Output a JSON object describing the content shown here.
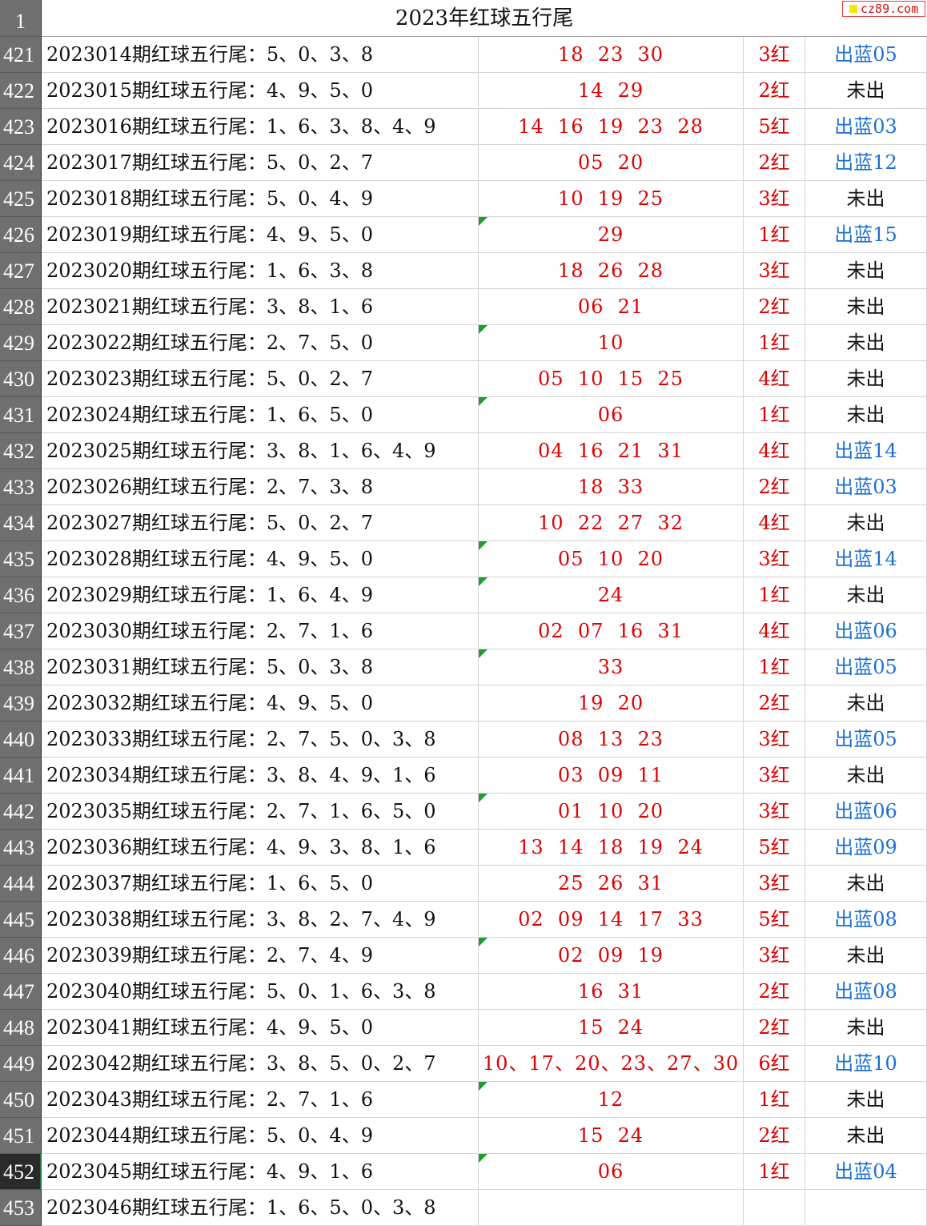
{
  "header": {
    "row_number": "1",
    "title": "2023年红球五行尾",
    "logo_text": "cz89.com"
  },
  "rows": [
    {
      "n": "421",
      "desc": "2023014期红球五行尾：5、0、3、8",
      "balls": "18  23  30",
      "hits": "3红",
      "blue": "出蓝05",
      "blue_hit": true,
      "flag": false
    },
    {
      "n": "422",
      "desc": "2023015期红球五行尾：4、9、5、0",
      "balls": "14  29",
      "hits": "2红",
      "blue": "未出",
      "blue_hit": false,
      "flag": false
    },
    {
      "n": "423",
      "desc": "2023016期红球五行尾：1、6、3、8、4、9",
      "balls": "14  16  19  23  28",
      "hits": "5红",
      "blue": "出蓝03",
      "blue_hit": true,
      "flag": false
    },
    {
      "n": "424",
      "desc": "2023017期红球五行尾：5、0、2、7",
      "balls": "05  20",
      "hits": "2红",
      "blue": "出蓝12",
      "blue_hit": true,
      "flag": false
    },
    {
      "n": "425",
      "desc": "2023018期红球五行尾：5、0、4、9",
      "balls": "10  19  25",
      "hits": "3红",
      "blue": "未出",
      "blue_hit": false,
      "flag": false
    },
    {
      "n": "426",
      "desc": "2023019期红球五行尾：4、9、5、0",
      "balls": "29",
      "hits": "1红",
      "blue": "出蓝15",
      "blue_hit": true,
      "flag": true
    },
    {
      "n": "427",
      "desc": "2023020期红球五行尾：1、6、3、8",
      "balls": "18  26  28",
      "hits": "3红",
      "blue": "未出",
      "blue_hit": false,
      "flag": false
    },
    {
      "n": "428",
      "desc": "2023021期红球五行尾：3、8、1、6",
      "balls": "06  21",
      "hits": "2红",
      "blue": "未出",
      "blue_hit": false,
      "flag": false
    },
    {
      "n": "429",
      "desc": "2023022期红球五行尾：2、7、5、0",
      "balls": "10",
      "hits": "1红",
      "blue": "未出",
      "blue_hit": false,
      "flag": true
    },
    {
      "n": "430",
      "desc": "2023023期红球五行尾：5、0、2、7",
      "balls": "05  10  15  25",
      "hits": "4红",
      "blue": "未出",
      "blue_hit": false,
      "flag": false
    },
    {
      "n": "431",
      "desc": "2023024期红球五行尾：1、6、5、0",
      "balls": "06",
      "hits": "1红",
      "blue": "未出",
      "blue_hit": false,
      "flag": true
    },
    {
      "n": "432",
      "desc": "2023025期红球五行尾：3、8、1、6、4、9",
      "balls": "04  16  21  31",
      "hits": "4红",
      "blue": "出蓝14",
      "blue_hit": true,
      "flag": false
    },
    {
      "n": "433",
      "desc": "2023026期红球五行尾：2、7、3、8",
      "balls": "18  33",
      "hits": "2红",
      "blue": "出蓝03",
      "blue_hit": true,
      "flag": false
    },
    {
      "n": "434",
      "desc": "2023027期红球五行尾：5、0、2、7",
      "balls": "10  22  27  32",
      "hits": "4红",
      "blue": "未出",
      "blue_hit": false,
      "flag": false
    },
    {
      "n": "435",
      "desc": "2023028期红球五行尾：4、9、5、0",
      "balls": "05  10  20",
      "hits": "3红",
      "blue": "出蓝14",
      "blue_hit": true,
      "flag": true
    },
    {
      "n": "436",
      "desc": "2023029期红球五行尾：1、6、4、9",
      "balls": "24",
      "hits": "1红",
      "blue": "未出",
      "blue_hit": false,
      "flag": true
    },
    {
      "n": "437",
      "desc": "2023030期红球五行尾：2、7、1、6",
      "balls": "02  07  16  31",
      "hits": "4红",
      "blue": "出蓝06",
      "blue_hit": true,
      "flag": false
    },
    {
      "n": "438",
      "desc": "2023031期红球五行尾：5、0、3、8",
      "balls": "33",
      "hits": "1红",
      "blue": "出蓝05",
      "blue_hit": true,
      "flag": true
    },
    {
      "n": "439",
      "desc": "2023032期红球五行尾：4、9、5、0",
      "balls": "19  20",
      "hits": "2红",
      "blue": "未出",
      "blue_hit": false,
      "flag": false
    },
    {
      "n": "440",
      "desc": "2023033期红球五行尾：2、7、5、0、3、8",
      "balls": "08  13  23",
      "hits": "3红",
      "blue": "出蓝05",
      "blue_hit": true,
      "flag": false
    },
    {
      "n": "441",
      "desc": "2023034期红球五行尾：3、8、4、9、1、6",
      "balls": "03  09  11",
      "hits": "3红",
      "blue": "未出",
      "blue_hit": false,
      "flag": false
    },
    {
      "n": "442",
      "desc": "2023035期红球五行尾：2、7、1、6、5、0",
      "balls": "01  10  20",
      "hits": "3红",
      "blue": "出蓝06",
      "blue_hit": true,
      "flag": true
    },
    {
      "n": "443",
      "desc": "2023036期红球五行尾：4、9、3、8、1、6",
      "balls": "13  14  18  19  24",
      "hits": "5红",
      "blue": "出蓝09",
      "blue_hit": true,
      "flag": false
    },
    {
      "n": "444",
      "desc": "2023037期红球五行尾：1、6、5、0",
      "balls": "25  26  31",
      "hits": "3红",
      "blue": "未出",
      "blue_hit": false,
      "flag": false
    },
    {
      "n": "445",
      "desc": "2023038期红球五行尾：3、8、2、7、4、9",
      "balls": "02  09  14  17  33",
      "hits": "5红",
      "blue": "出蓝08",
      "blue_hit": true,
      "flag": false
    },
    {
      "n": "446",
      "desc": "2023039期红球五行尾：2、7、4、9",
      "balls": "02  09  19",
      "hits": "3红",
      "blue": "未出",
      "blue_hit": false,
      "flag": true
    },
    {
      "n": "447",
      "desc": "2023040期红球五行尾：5、0、1、6、3、8",
      "balls": "16  31",
      "hits": "2红",
      "blue": "出蓝08",
      "blue_hit": true,
      "flag": false
    },
    {
      "n": "448",
      "desc": "2023041期红球五行尾：4、9、5、0",
      "balls": "15  24",
      "hits": "2红",
      "blue": "未出",
      "blue_hit": false,
      "flag": false
    },
    {
      "n": "449",
      "desc": "2023042期红球五行尾：3、8、5、0、2、7",
      "balls": "10、17、20、23、27、30",
      "hits": "6红",
      "blue": "出蓝10",
      "blue_hit": true,
      "flag": false
    },
    {
      "n": "450",
      "desc": "2023043期红球五行尾：2、7、1、6",
      "balls": "12",
      "hits": "1红",
      "blue": "未出",
      "blue_hit": false,
      "flag": true
    },
    {
      "n": "451",
      "desc": "2023044期红球五行尾：5、0、4、9",
      "balls": "15  24",
      "hits": "2红",
      "blue": "未出",
      "blue_hit": false,
      "flag": false
    },
    {
      "n": "452",
      "desc": "2023045期红球五行尾：4、9、1、6",
      "balls": "06",
      "hits": "1红",
      "blue": "出蓝04",
      "blue_hit": true,
      "flag": true,
      "active": true
    },
    {
      "n": "453",
      "desc": "2023046期红球五行尾：1、6、5、0、3、8",
      "balls": "",
      "hits": "",
      "blue": "",
      "blue_hit": false,
      "flag": false
    }
  ],
  "colors": {
    "ball_red": "#e00000",
    "blue_hit": "#1a6fd6",
    "text": "#111111",
    "rownum_bg": "#6f6f6f",
    "flag_green": "#1e9e2e"
  }
}
